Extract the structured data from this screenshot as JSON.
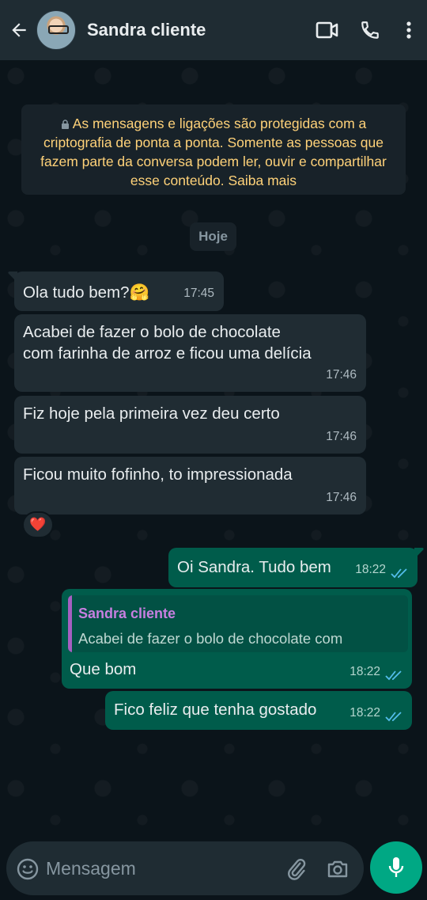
{
  "header": {
    "contact_name": "Sandra cliente",
    "back_icon": "arrow-left-icon",
    "video_icon": "video-call-icon",
    "call_icon": "phone-icon",
    "menu_icon": "more-vert-icon"
  },
  "encryption_notice": {
    "text": "As mensagens e ligações são protegidas com a criptografia de ponta a ponta. Somente as pessoas que fazem parte da conversa podem ler, ouvir e compartilhar esse conteúdo. Saiba mais",
    "icon": "lock-icon"
  },
  "date_separator": "Hoje",
  "messages": [
    {
      "direction": "in",
      "text": "Ola tudo bem?🤗",
      "time": "17:45"
    },
    {
      "direction": "in",
      "text_line1": "Acabei de fazer o bolo de chocolate",
      "text_line2": "com farinha de arroz e ficou uma delícia",
      "time": "17:46"
    },
    {
      "direction": "in",
      "text": "Fiz hoje pela primeira vez deu certo",
      "time": "17:46"
    },
    {
      "direction": "in",
      "text": "Ficou muito fofinho, to impressionada",
      "time": "17:46",
      "reaction": "❤️"
    },
    {
      "direction": "out",
      "text": "Oi Sandra. Tudo bem",
      "time": "18:22",
      "status": "read"
    },
    {
      "direction": "out",
      "quoted_author": "Sandra cliente",
      "quoted_text": "Acabei de fazer o bolo de chocolate com",
      "text": "Que bom",
      "time": "18:22",
      "status": "read"
    },
    {
      "direction": "out",
      "text": "Fico feliz que tenha gostado",
      "time": "18:22",
      "status": "read"
    }
  ],
  "composer": {
    "placeholder": "Mensagem",
    "emoji_icon": "emoji-icon",
    "attach_icon": "paperclip-icon",
    "camera_icon": "camera-icon",
    "mic_icon": "microphone-icon"
  },
  "colors": {
    "background": "#0b141a",
    "header": "#1f2c33",
    "incoming_bubble": "#202c33",
    "outgoing_bubble": "#005c4b",
    "accent": "#00a884",
    "read_ticks": "#53bdeb",
    "notice_text": "#ffd279"
  }
}
